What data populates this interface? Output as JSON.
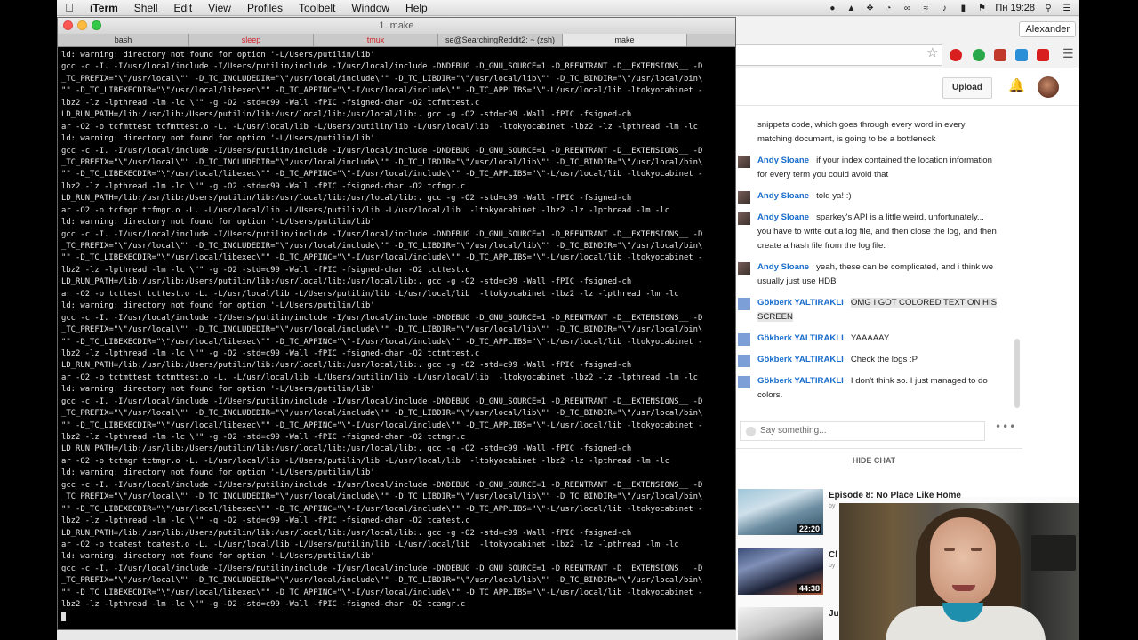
{
  "menubar": {
    "app_name": "iTerm",
    "items": [
      "Shell",
      "Edit",
      "View",
      "Profiles",
      "Toolbelt",
      "Window",
      "Help"
    ],
    "clock": "Пн 19:28",
    "icons": [
      "github-icon",
      "bell-icon",
      "dropbox-icon",
      "wifi-icon",
      "volume-icon",
      "battery-icon",
      "flag-icon",
      "search-icon",
      "list-icon"
    ]
  },
  "terminal": {
    "title": "1. make",
    "tabs": [
      {
        "label": "bash",
        "color": "#222222"
      },
      {
        "label": "sleep",
        "color": "#d2232a"
      },
      {
        "label": "tmux",
        "color": "#d2232a"
      },
      {
        "label": "se@SearchingReddit2: ~ (zsh)",
        "color": "#222222"
      },
      {
        "label": "make",
        "color": "#222222"
      }
    ],
    "lines": [
      "ld: warning: directory not found for option '-L/Users/putilin/lib'",
      "gcc -c -I. -I/usr/local/include -I/Users/putilin/include -I/usr/local/include -DNDEBUG -D_GNU_SOURCE=1 -D_REENTRANT -D__EXTENSIONS__ -D",
      "_TC_PREFIX=\"\\\"/usr/local\\\"\" -D_TC_INCLUDEDIR=\"\\\"/usr/local/include\\\"\" -D_TC_LIBDIR=\"\\\"/usr/local/lib\\\"\" -D_TC_BINDIR=\"\\\"/usr/local/bin\\",
      "\"\" -D_TC_LIBEXECDIR=\"\\\"/usr/local/libexec\\\"\" -D_TC_APPINC=\"\\\"-I/usr/local/include\\\"\" -D_TC_APPLIBS=\"\\\"-L/usr/local/lib -ltokyocabinet -",
      "lbz2 -lz -lpthread -lm -lc \\\"\" -g -O2 -std=c99 -Wall -fPIC -fsigned-char -O2 tcfmttest.c",
      "LD_RUN_PATH=/lib:/usr/lib:/Users/putilin/lib:/usr/local/lib:/usr/local/lib:. gcc -g -O2 -std=c99 -Wall -fPIC -fsigned-ch",
      "ar -O2 -o tcfmttest tcfmttest.o -L. -L/usr/local/lib -L/Users/putilin/lib -L/usr/local/lib  -ltokyocabinet -lbz2 -lz -lpthread -lm -lc",
      "ld: warning: directory not found for option '-L/Users/putilin/lib'",
      "gcc -c -I. -I/usr/local/include -I/Users/putilin/include -I/usr/local/include -DNDEBUG -D_GNU_SOURCE=1 -D_REENTRANT -D__EXTENSIONS__ -D",
      "_TC_PREFIX=\"\\\"/usr/local\\\"\" -D_TC_INCLUDEDIR=\"\\\"/usr/local/include\\\"\" -D_TC_LIBDIR=\"\\\"/usr/local/lib\\\"\" -D_TC_BINDIR=\"\\\"/usr/local/bin\\",
      "\"\" -D_TC_LIBEXECDIR=\"\\\"/usr/local/libexec\\\"\" -D_TC_APPINC=\"\\\"-I/usr/local/include\\\"\" -D_TC_APPLIBS=\"\\\"-L/usr/local/lib -ltokyocabinet -",
      "lbz2 -lz -lpthread -lm -lc \\\"\" -g -O2 -std=c99 -Wall -fPIC -fsigned-char -O2 tcfmgr.c",
      "LD_RUN_PATH=/lib:/usr/lib:/Users/putilin/lib:/usr/local/lib:/usr/local/lib:. gcc -g -O2 -std=c99 -Wall -fPIC -fsigned-ch",
      "ar -O2 -o tcfmgr tcfmgr.o -L. -L/usr/local/lib -L/Users/putilin/lib -L/usr/local/lib  -ltokyocabinet -lbz2 -lz -lpthread -lm -lc",
      "ld: warning: directory not found for option '-L/Users/putilin/lib'",
      "gcc -c -I. -I/usr/local/include -I/Users/putilin/include -I/usr/local/include -DNDEBUG -D_GNU_SOURCE=1 -D_REENTRANT -D__EXTENSIONS__ -D",
      "_TC_PREFIX=\"\\\"/usr/local\\\"\" -D_TC_INCLUDEDIR=\"\\\"/usr/local/include\\\"\" -D_TC_LIBDIR=\"\\\"/usr/local/lib\\\"\" -D_TC_BINDIR=\"\\\"/usr/local/bin\\",
      "\"\" -D_TC_LIBEXECDIR=\"\\\"/usr/local/libexec\\\"\" -D_TC_APPINC=\"\\\"-I/usr/local/include\\\"\" -D_TC_APPLIBS=\"\\\"-L/usr/local/lib -ltokyocabinet -",
      "lbz2 -lz -lpthread -lm -lc \\\"\" -g -O2 -std=c99 -Wall -fPIC -fsigned-char -O2 tcttest.c",
      "LD_RUN_PATH=/lib:/usr/lib:/Users/putilin/lib:/usr/local/lib:/usr/local/lib:. gcc -g -O2 -std=c99 -Wall -fPIC -fsigned-ch",
      "ar -O2 -o tcttest tcttest.o -L. -L/usr/local/lib -L/Users/putilin/lib -L/usr/local/lib  -ltokyocabinet -lbz2 -lz -lpthread -lm -lc",
      "ld: warning: directory not found for option '-L/Users/putilin/lib'",
      "gcc -c -I. -I/usr/local/include -I/Users/putilin/include -I/usr/local/include -DNDEBUG -D_GNU_SOURCE=1 -D_REENTRANT -D__EXTENSIONS__ -D",
      "_TC_PREFIX=\"\\\"/usr/local\\\"\" -D_TC_INCLUDEDIR=\"\\\"/usr/local/include\\\"\" -D_TC_LIBDIR=\"\\\"/usr/local/lib\\\"\" -D_TC_BINDIR=\"\\\"/usr/local/bin\\",
      "\"\" -D_TC_LIBEXECDIR=\"\\\"/usr/local/libexec\\\"\" -D_TC_APPINC=\"\\\"-I/usr/local/include\\\"\" -D_TC_APPLIBS=\"\\\"-L/usr/local/lib -ltokyocabinet -",
      "lbz2 -lz -lpthread -lm -lc \\\"\" -g -O2 -std=c99 -Wall -fPIC -fsigned-char -O2 tctmttest.c",
      "LD_RUN_PATH=/lib:/usr/lib:/Users/putilin/lib:/usr/local/lib:/usr/local/lib:. gcc -g -O2 -std=c99 -Wall -fPIC -fsigned-ch",
      "ar -O2 -o tctmttest tctmttest.o -L. -L/usr/local/lib -L/Users/putilin/lib -L/usr/local/lib  -ltokyocabinet -lbz2 -lz -lpthread -lm -lc",
      "ld: warning: directory not found for option '-L/Users/putilin/lib'",
      "gcc -c -I. -I/usr/local/include -I/Users/putilin/include -I/usr/local/include -DNDEBUG -D_GNU_SOURCE=1 -D_REENTRANT -D__EXTENSIONS__ -D",
      "_TC_PREFIX=\"\\\"/usr/local\\\"\" -D_TC_INCLUDEDIR=\"\\\"/usr/local/include\\\"\" -D_TC_LIBDIR=\"\\\"/usr/local/lib\\\"\" -D_TC_BINDIR=\"\\\"/usr/local/bin\\",
      "\"\" -D_TC_LIBEXECDIR=\"\\\"/usr/local/libexec\\\"\" -D_TC_APPINC=\"\\\"-I/usr/local/include\\\"\" -D_TC_APPLIBS=\"\\\"-L/usr/local/lib -ltokyocabinet -",
      "lbz2 -lz -lpthread -lm -lc \\\"\" -g -O2 -std=c99 -Wall -fPIC -fsigned-char -O2 tctmgr.c",
      "LD_RUN_PATH=/lib:/usr/lib:/Users/putilin/lib:/usr/local/lib:/usr/local/lib:. gcc -g -O2 -std=c99 -Wall -fPIC -fsigned-ch",
      "ar -O2 -o tctmgr tctmgr.o -L. -L/usr/local/lib -L/Users/putilin/lib -L/usr/local/lib  -ltokyocabinet -lbz2 -lz -lpthread -lm -lc",
      "ld: warning: directory not found for option '-L/Users/putilin/lib'",
      "gcc -c -I. -I/usr/local/include -I/Users/putilin/include -I/usr/local/include -DNDEBUG -D_GNU_SOURCE=1 -D_REENTRANT -D__EXTENSIONS__ -D",
      "_TC_PREFIX=\"\\\"/usr/local\\\"\" -D_TC_INCLUDEDIR=\"\\\"/usr/local/include\\\"\" -D_TC_LIBDIR=\"\\\"/usr/local/lib\\\"\" -D_TC_BINDIR=\"\\\"/usr/local/bin\\",
      "\"\" -D_TC_LIBEXECDIR=\"\\\"/usr/local/libexec\\\"\" -D_TC_APPINC=\"\\\"-I/usr/local/include\\\"\" -D_TC_APPLIBS=\"\\\"-L/usr/local/lib -ltokyocabinet -",
      "lbz2 -lz -lpthread -lm -lc \\\"\" -g -O2 -std=c99 -Wall -fPIC -fsigned-char -O2 tcatest.c",
      "LD_RUN_PATH=/lib:/usr/lib:/Users/putilin/lib:/usr/local/lib:/usr/local/lib:. gcc -g -O2 -std=c99 -Wall -fPIC -fsigned-ch",
      "ar -O2 -o tcatest tcatest.o -L. -L/usr/local/lib -L/Users/putilin/lib -L/usr/local/lib  -ltokyocabinet -lbz2 -lz -lpthread -lm -lc",
      "ld: warning: directory not found for option '-L/Users/putilin/lib'",
      "gcc -c -I. -I/usr/local/include -I/Users/putilin/include -I/usr/local/include -DNDEBUG -D_GNU_SOURCE=1 -D_REENTRANT -D__EXTENSIONS__ -D",
      "_TC_PREFIX=\"\\\"/usr/local\\\"\" -D_TC_INCLUDEDIR=\"\\\"/usr/local/include\\\"\" -D_TC_LIBDIR=\"\\\"/usr/local/lib\\\"\" -D_TC_BINDIR=\"\\\"/usr/local/bin\\",
      "\"\" -D_TC_LIBEXECDIR=\"\\\"/usr/local/libexec\\\"\" -D_TC_APPINC=\"\\\"-I/usr/local/include\\\"\" -D_TC_APPLIBS=\"\\\"-L/usr/local/lib -ltokyocabinet -",
      "lbz2 -lz -lpthread -lm -lc \\\"\" -g -O2 -std=c99 -Wall -fPIC -fsigned-char -O2 tcamgr.c"
    ]
  },
  "browser": {
    "user_name": "Alexander",
    "upload_label": "Upload",
    "extension_colors": [
      "#d81e1e",
      "#2aa84a",
      "#c0392b",
      "#2a8fd6",
      "#d81e1e"
    ],
    "chat": {
      "messages": [
        {
          "author": "",
          "text": "snippets code, which goes through every word in every matching document, is going to be a bottleneck",
          "avatar": "none"
        },
        {
          "author": "Andy Sloane",
          "text": "if your index contained the location information for every term you could avoid that",
          "avatar": "dark"
        },
        {
          "author": "Andy Sloane",
          "text": "told ya! :)",
          "avatar": "dark"
        },
        {
          "author": "Andy Sloane",
          "text": "sparkey's API is a little weird, unfortunately... you have to write out a log file, and then close the log, and then create a hash file from the log file.",
          "avatar": "dark"
        },
        {
          "author": "Andy Sloane",
          "text": "yeah, these can be complicated, and i think we usually just use HDB",
          "avatar": "dark"
        },
        {
          "author": "Gökberk YALTIRAKLI",
          "text": "OMG I GOT COLORED TEXT ON HIS SCREEN",
          "avatar": "blue",
          "highlighted": true
        },
        {
          "author": "Gökberk YALTIRAKLI",
          "text": "YAAAAAY",
          "avatar": "blue"
        },
        {
          "author": "Gökberk YALTIRAKLI",
          "text": "Check the logs :P",
          "avatar": "blue"
        },
        {
          "author": "Gökberk YALTIRAKLI",
          "text": "I don't think so. I just managed to do colors.",
          "avatar": "blue"
        }
      ],
      "input_placeholder": "Say something...",
      "hide_chat_label": "HIDE CHAT"
    },
    "recommendations": [
      {
        "title": "Episode 8: No Place Like Home",
        "meta": "by",
        "duration": "22:20"
      },
      {
        "title": "Cl",
        "meta": "by",
        "duration": "44:38"
      },
      {
        "title": "Ju",
        "meta": "",
        "duration": ""
      }
    ]
  },
  "colors": {
    "chat_author": "#1a6dcc",
    "terminal_text": "#e8e8e8",
    "tab_alert": "#d2232a"
  }
}
